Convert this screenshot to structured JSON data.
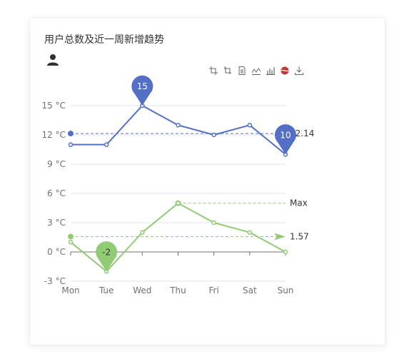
{
  "card": {
    "title": "用户总数及近一周新增趋势"
  },
  "icons": {
    "user": "user-icon",
    "toolbox": [
      "crop-zoom-icon",
      "zoom-reset-icon",
      "data-view-icon",
      "line-switch-icon",
      "bar-switch-icon",
      "restore-icon",
      "download-icon"
    ]
  },
  "colors": {
    "high": "#5470c6",
    "low": "#91cc75",
    "axis": "#6e7079",
    "grid": "#e0e6f1"
  },
  "chart_data": {
    "type": "line",
    "categories": [
      "Mon",
      "Tue",
      "Wed",
      "Thu",
      "Fri",
      "Sat",
      "Sun"
    ],
    "y_ticks": [
      "15 °C",
      "12 °C",
      "9 °C",
      "6 °C",
      "3 °C",
      "0 °C",
      "-3 °C"
    ],
    "ylim": [
      -3,
      15
    ],
    "series": [
      {
        "values": [
          11,
          11,
          15,
          13,
          12,
          13,
          10
        ],
        "max_pin": {
          "category": "Wed",
          "value": 15,
          "label": "15"
        },
        "min_pin": {
          "category": "Sun",
          "value": 10,
          "label": "10"
        },
        "average_line": {
          "value": 12.14,
          "label": "12.14"
        }
      },
      {
        "values": [
          1,
          -2,
          2,
          5,
          3,
          2,
          0
        ],
        "min_pin": {
          "category": "Tue",
          "value": -2,
          "label": "-2"
        },
        "average_line": {
          "value": 1.57,
          "label": "1.57"
        },
        "max_line": {
          "from": "Thu",
          "to": "Sun",
          "value": 5,
          "label": "Max"
        }
      }
    ],
    "grid": true,
    "legend": "none"
  }
}
